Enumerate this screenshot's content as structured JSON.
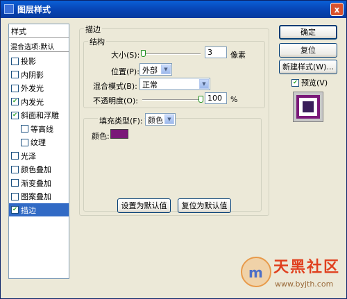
{
  "window": {
    "title": "图层样式",
    "close_glyph": "x"
  },
  "styles_panel": {
    "header": "样式",
    "blend_options": "混合选项:默认",
    "items": [
      {
        "label": "投影",
        "checked": false,
        "selected": false
      },
      {
        "label": "内阴影",
        "checked": false,
        "selected": false
      },
      {
        "label": "外发光",
        "checked": false,
        "selected": false
      },
      {
        "label": "内发光",
        "checked": true,
        "selected": false
      },
      {
        "label": "斜面和浮雕",
        "checked": true,
        "selected": false
      },
      {
        "label": "等高线",
        "checked": false,
        "selected": false
      },
      {
        "label": "纹理",
        "checked": false,
        "selected": false
      },
      {
        "label": "光泽",
        "checked": false,
        "selected": false
      },
      {
        "label": "颜色叠加",
        "checked": false,
        "selected": false
      },
      {
        "label": "渐变叠加",
        "checked": false,
        "selected": false
      },
      {
        "label": "图案叠加",
        "checked": false,
        "selected": false
      },
      {
        "label": "描边",
        "checked": true,
        "selected": true
      }
    ]
  },
  "stroke": {
    "group_title": "描边",
    "structure_title": "结构",
    "size_label": "大小(S):",
    "size_value": "3",
    "size_slider": {
      "value": 3,
      "max": 250
    },
    "size_unit": "像素",
    "position_label": "位置(P):",
    "position_value": "外部",
    "blend_mode_label": "混合模式(B):",
    "blend_mode_value": "正常",
    "opacity_label": "不透明度(O):",
    "opacity_value": "100",
    "opacity_slider": {
      "value": 100,
      "max": 100
    },
    "opacity_unit": "%",
    "fill_type_label": "填充类型(F):",
    "fill_type_value": "颜色",
    "color_label": "颜色:",
    "color_hex": "#7A1878"
  },
  "buttons": {
    "ok": "确定",
    "reset": "复位",
    "new_style": "新建样式(W)...",
    "preview_label": "预览(V)",
    "preview_checked": true,
    "set_default": "设置为默认值",
    "reset_default": "复位为默认值"
  },
  "watermark": {
    "text": "天黑社区",
    "url": "www.byjth.com"
  }
}
